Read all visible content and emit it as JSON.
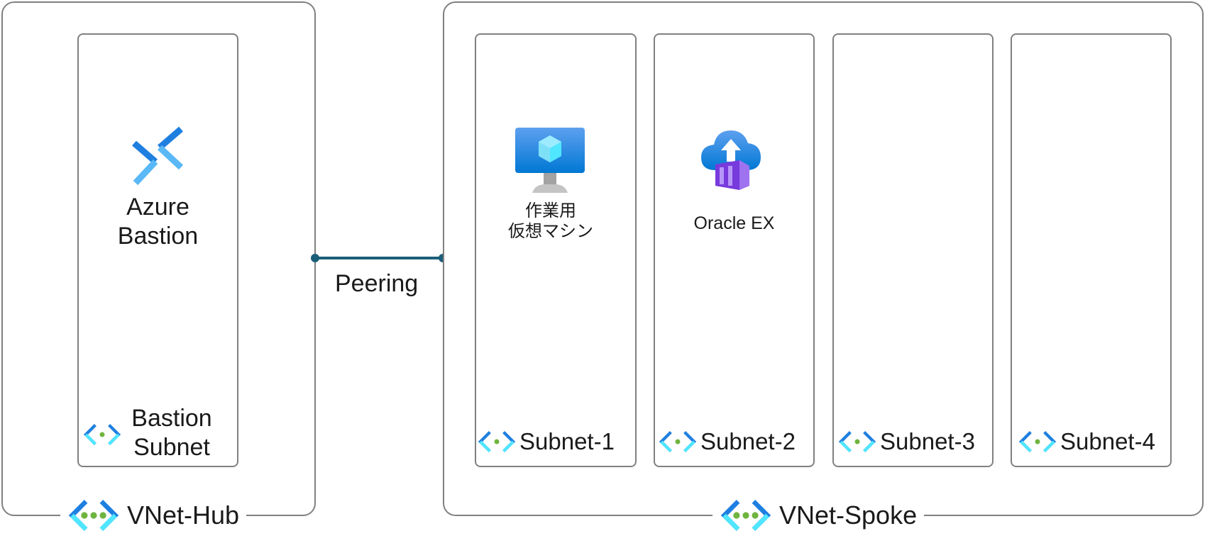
{
  "hub": {
    "name": "VNet-Hub",
    "subnet": {
      "label_line1": "Bastion",
      "label_line2": "Subnet",
      "resource_line1": "Azure",
      "resource_line2": "Bastion"
    }
  },
  "peering": {
    "label": "Peering",
    "color": "#1b5e7a"
  },
  "spoke": {
    "name": "VNet-Spoke",
    "subnets": [
      {
        "label": "Subnet-1",
        "resource_line1": "作業用",
        "resource_line2": "仮想マシン"
      },
      {
        "label": "Subnet-2",
        "resource": "Oracle EX"
      },
      {
        "label": "Subnet-3"
      },
      {
        "label": "Subnet-4"
      }
    ]
  },
  "colors": {
    "border": "#808080",
    "azure_blue": "#1f7fe0",
    "azure_light": "#59b8f5",
    "green_dot": "#6fb43f",
    "purple": "#8b5cf6"
  },
  "icons": {
    "vnet": "virtual-network-icon",
    "bastion": "bastion-icon",
    "vm": "virtual-machine-icon",
    "oracle": "cloud-upload-container-icon"
  }
}
